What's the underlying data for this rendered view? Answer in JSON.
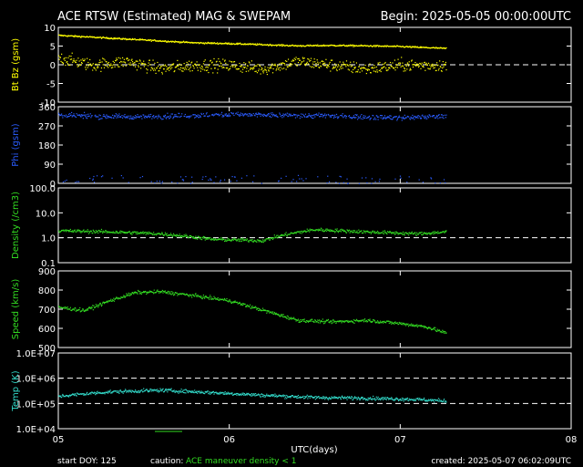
{
  "header": {
    "title": "ACE RTSW (Estimated) MAG & SWEPAM",
    "begin": "Begin: 2025-05-05 00:00:00UTC"
  },
  "xaxis": {
    "label": "UTC(days)",
    "ticks": [
      "05",
      "06",
      "07",
      "08"
    ]
  },
  "footer": {
    "start_doy": "start DOY: 125",
    "caution_label": "caution:",
    "caution_text": "ACE maneuver  density < 1",
    "created": "created: 2025-05-07 06:02:09UTC"
  },
  "colors": {
    "mag": "#ffff00",
    "phi": "#2a5cff",
    "density": "#33dd22",
    "speed": "#33dd22",
    "temp": "#33ddcc",
    "caution": "#33dd22",
    "frame": "#ffffff"
  },
  "chart_data": [
    {
      "type": "scatter",
      "ylabel": "Bt Bz (gsm)",
      "ylim": [
        -10,
        10
      ],
      "yticks": [
        "10",
        "5",
        "0",
        "-5",
        "-10"
      ],
      "dashed_ref": [
        0
      ],
      "data_end_day": 2.27,
      "series": [
        {
          "name": "Bt",
          "x": [
            0,
            0.2,
            0.4,
            0.6,
            0.8,
            1.0,
            1.2,
            1.4,
            1.6,
            1.8,
            2.0,
            2.27
          ],
          "values": [
            8,
            7.5,
            7,
            6.5,
            6,
            5.8,
            5.5,
            5.2,
            5.3,
            5.2,
            5.0,
            4.5
          ]
        },
        {
          "name": "Bz",
          "x": [
            0,
            0.2,
            0.4,
            0.6,
            0.8,
            1.0,
            1.2,
            1.4,
            1.6,
            1.8,
            2.0,
            2.27
          ],
          "values": [
            2,
            0,
            1,
            -1,
            0,
            0,
            -1,
            1,
            0,
            -1,
            0,
            0
          ]
        }
      ]
    },
    {
      "type": "scatter",
      "ylabel": "Phi (gsm)",
      "ylim": [
        0,
        360
      ],
      "yticks": [
        "360",
        "270",
        "180",
        "90",
        "0"
      ],
      "data_end_day": 2.27,
      "series": [
        {
          "name": "Phi",
          "x": [
            0,
            0.5,
            1.0,
            1.5,
            2.0,
            2.27
          ],
          "values": [
            320,
            315,
            325,
            320,
            310,
            320
          ]
        }
      ]
    },
    {
      "type": "scatter",
      "ylabel": "Density (/cm3)",
      "yscale": "log",
      "ylim": [
        0.1,
        100
      ],
      "yticks": [
        "100.0",
        "10.0",
        "1.0",
        "0.1"
      ],
      "dashed_ref": [
        1
      ],
      "data_end_day": 2.27,
      "series": [
        {
          "name": "Density",
          "x": [
            0,
            0.3,
            0.6,
            0.9,
            1.2,
            1.5,
            1.8,
            2.1,
            2.27
          ],
          "values": [
            2.0,
            1.8,
            1.5,
            0.9,
            0.8,
            2.2,
            1.8,
            1.5,
            1.8
          ]
        }
      ]
    },
    {
      "type": "scatter",
      "ylabel": "Speed (km/s)",
      "ylim": [
        450,
        920
      ],
      "yticks": [
        "900",
        "800",
        "700",
        "600",
        "500"
      ],
      "data_end_day": 2.27,
      "series": [
        {
          "name": "Speed",
          "x": [
            0,
            0.15,
            0.3,
            0.45,
            0.6,
            0.8,
            1.0,
            1.2,
            1.4,
            1.6,
            1.8,
            2.0,
            2.15,
            2.27
          ],
          "values": [
            700,
            680,
            740,
            790,
            795,
            770,
            740,
            680,
            620,
            610,
            620,
            600,
            580,
            540
          ]
        }
      ]
    },
    {
      "type": "scatter",
      "ylabel": "Temp (K)",
      "yscale": "log",
      "ylim": [
        10000,
        10000000
      ],
      "yticks": [
        "1.0E+07",
        "1.0E+06",
        "1.0E+05",
        "1.0E+04"
      ],
      "dashed_ref": [
        1000000,
        100000
      ],
      "data_end_day": 2.27,
      "series": [
        {
          "name": "Temp",
          "x": [
            0,
            0.3,
            0.6,
            0.9,
            1.2,
            1.5,
            1.8,
            2.1,
            2.27
          ],
          "values": [
            200000,
            300000,
            350000,
            280000,
            220000,
            180000,
            170000,
            150000,
            130000
          ]
        }
      ]
    }
  ]
}
